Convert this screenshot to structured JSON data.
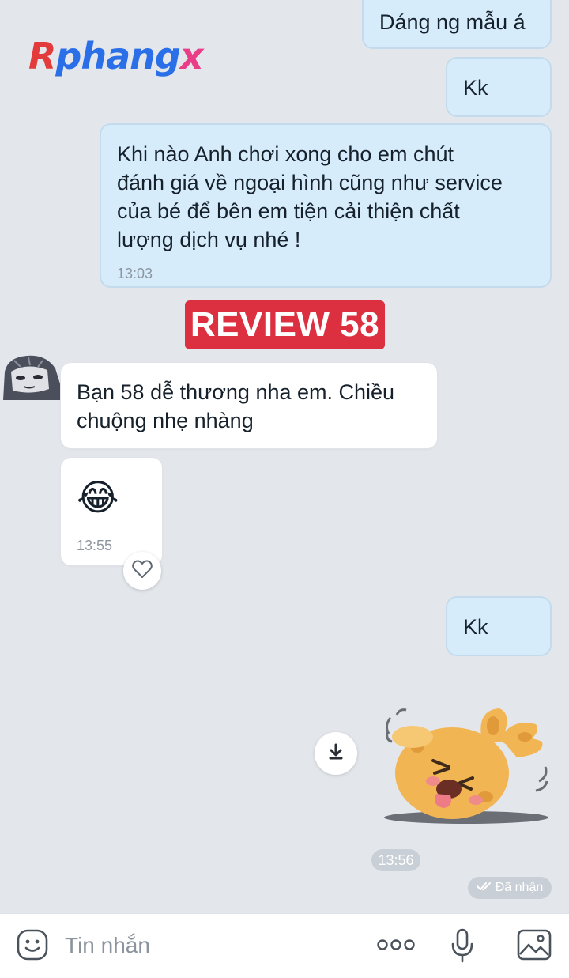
{
  "watermark": {
    "logo_part1": "R",
    "logo_part2": "phang",
    "logo_part3": "x"
  },
  "banner": {
    "text": "REVIEW 58"
  },
  "messages": {
    "m1": {
      "text": "Dáng ng mẫu á"
    },
    "m2": {
      "text": "Kk"
    },
    "m3": {
      "line1": "Khi nào Anh chơi xong cho em chút",
      "line2": "đánh giá về ngoại hình cũng như service",
      "line3": "của bé để bên em tiện cải thiện chất",
      "line4": "lượng dịch vụ nhé !",
      "time": "13:03"
    },
    "m4": {
      "line1": "Bạn 58 dễ thương nha em. Chiều",
      "line2": "chuộng nhẹ nhàng"
    },
    "m5": {
      "emoji": "😂",
      "time": "13:55"
    },
    "m6": {
      "text": "Kk"
    },
    "sticker_time": "13:56",
    "status": "Đã nhận"
  },
  "input": {
    "placeholder": "Tin nhắn"
  },
  "icons": {
    "sticker": "sticker-face-icon",
    "more": "more-dots-icon",
    "mic": "microphone-icon",
    "gallery": "image-icon",
    "heart": "heart-icon",
    "download": "download-icon"
  },
  "colors": {
    "background": "#e3e7ec",
    "outgoing_bubble": "#d6ecfb",
    "incoming_bubble": "#ffffff",
    "banner": "#dc2f3f"
  }
}
